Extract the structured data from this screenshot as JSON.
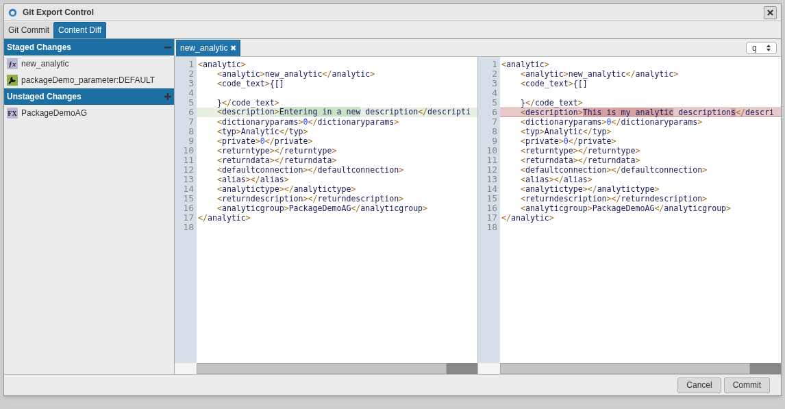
{
  "window": {
    "title": "Git Export Control"
  },
  "tabs": [
    {
      "label": "Git Commit",
      "selected": false
    },
    {
      "label": "Content Diff",
      "selected": true
    }
  ],
  "sidebar": {
    "sections": [
      {
        "title": "Staged Changes",
        "expanded": true,
        "items": [
          {
            "label": "new_analytic",
            "kind": "function",
            "icon_text": "ƒx"
          },
          {
            "label": "packageDemo_parameter:DEFAULT",
            "kind": "parameter"
          }
        ]
      },
      {
        "title": "Unstaged Changes",
        "expanded": false,
        "items": [
          {
            "label": "PackageDemoAG",
            "kind": "group",
            "icon_text": "FX"
          }
        ]
      }
    ]
  },
  "editor_tabs": [
    {
      "label": "new_analytic",
      "close": "✖",
      "selected": true
    }
  ],
  "view_select": {
    "value": "q"
  },
  "panes": [
    {
      "lines": [
        {
          "n": "1",
          "text": "<analytic>"
        },
        {
          "n": "2",
          "text": "    <analytic>new_analytic</analytic>"
        },
        {
          "n": "3",
          "text": "    <code_text>{[]"
        },
        {
          "n": "4"
        },
        {
          "n": "5",
          "text": "    }</code_text>"
        },
        {
          "n": "6",
          "kind": "added",
          "parts": [
            {
              "text": "    <description>",
              "marked": false
            },
            {
              "text": "Entering in a new",
              "marked": true
            },
            {
              "text": " description</descripti",
              "marked": false
            }
          ]
        },
        {
          "n": "7",
          "text": "    <dictionaryparams>0</dictionaryparams>"
        },
        {
          "n": "8",
          "text": "    <typ>Analytic</typ>"
        },
        {
          "n": "9",
          "text": "    <private>0</private>"
        },
        {
          "n": "10",
          "text": "    <returntype></returntype>"
        },
        {
          "n": "11",
          "text": "    <returndata></returndata>"
        },
        {
          "n": "12",
          "text": "    <defaultconnection></defaultconnection>"
        },
        {
          "n": "13",
          "text": "    <alias></alias>"
        },
        {
          "n": "14",
          "text": "    <analytictype></analytictype>"
        },
        {
          "n": "15",
          "text": "    <returndescription></returndescription>"
        },
        {
          "n": "16",
          "text": "    <analyticgroup>PackageDemoAG</analyticgroup>"
        },
        {
          "n": "17",
          "text": "</analytic>"
        },
        {
          "n": "18"
        }
      ]
    },
    {
      "lines": [
        {
          "n": "1",
          "text": "<analytic>"
        },
        {
          "n": "2",
          "text": "    <analytic>new_analytic</analytic>"
        },
        {
          "n": "3",
          "text": "    <code_text>{[]"
        },
        {
          "n": "4"
        },
        {
          "n": "5",
          "text": "    }</code_text>"
        },
        {
          "n": "6",
          "kind": "removed",
          "parts": [
            {
              "text": "    <description>",
              "marked": false
            },
            {
              "text": "This is my analytic",
              "marked": true
            },
            {
              "text": " description",
              "marked": false
            },
            {
              "text": "s",
              "marked": true
            },
            {
              "text": "</descri",
              "marked": false
            }
          ]
        },
        {
          "n": "7",
          "text": "    <dictionaryparams>0</dictionaryparams>"
        },
        {
          "n": "8",
          "text": "    <typ>Analytic</typ>"
        },
        {
          "n": "9",
          "text": "    <private>0</private>"
        },
        {
          "n": "10",
          "text": "    <returntype></returntype>"
        },
        {
          "n": "11",
          "text": "    <returndata></returndata>"
        },
        {
          "n": "12",
          "text": "    <defaultconnection></defaultconnection>"
        },
        {
          "n": "13",
          "text": "    <alias></alias>"
        },
        {
          "n": "14",
          "text": "    <analytictype></analytictype>"
        },
        {
          "n": "15",
          "text": "    <returndescription></returndescription>"
        },
        {
          "n": "16",
          "text": "    <analyticgroup>PackageDemoAG</analyticgroup>"
        },
        {
          "n": "17",
          "text": "</analytic>"
        },
        {
          "n": "18"
        }
      ]
    }
  ],
  "buttons": [
    {
      "label": "Cancel"
    },
    {
      "label": "Commit"
    }
  ]
}
